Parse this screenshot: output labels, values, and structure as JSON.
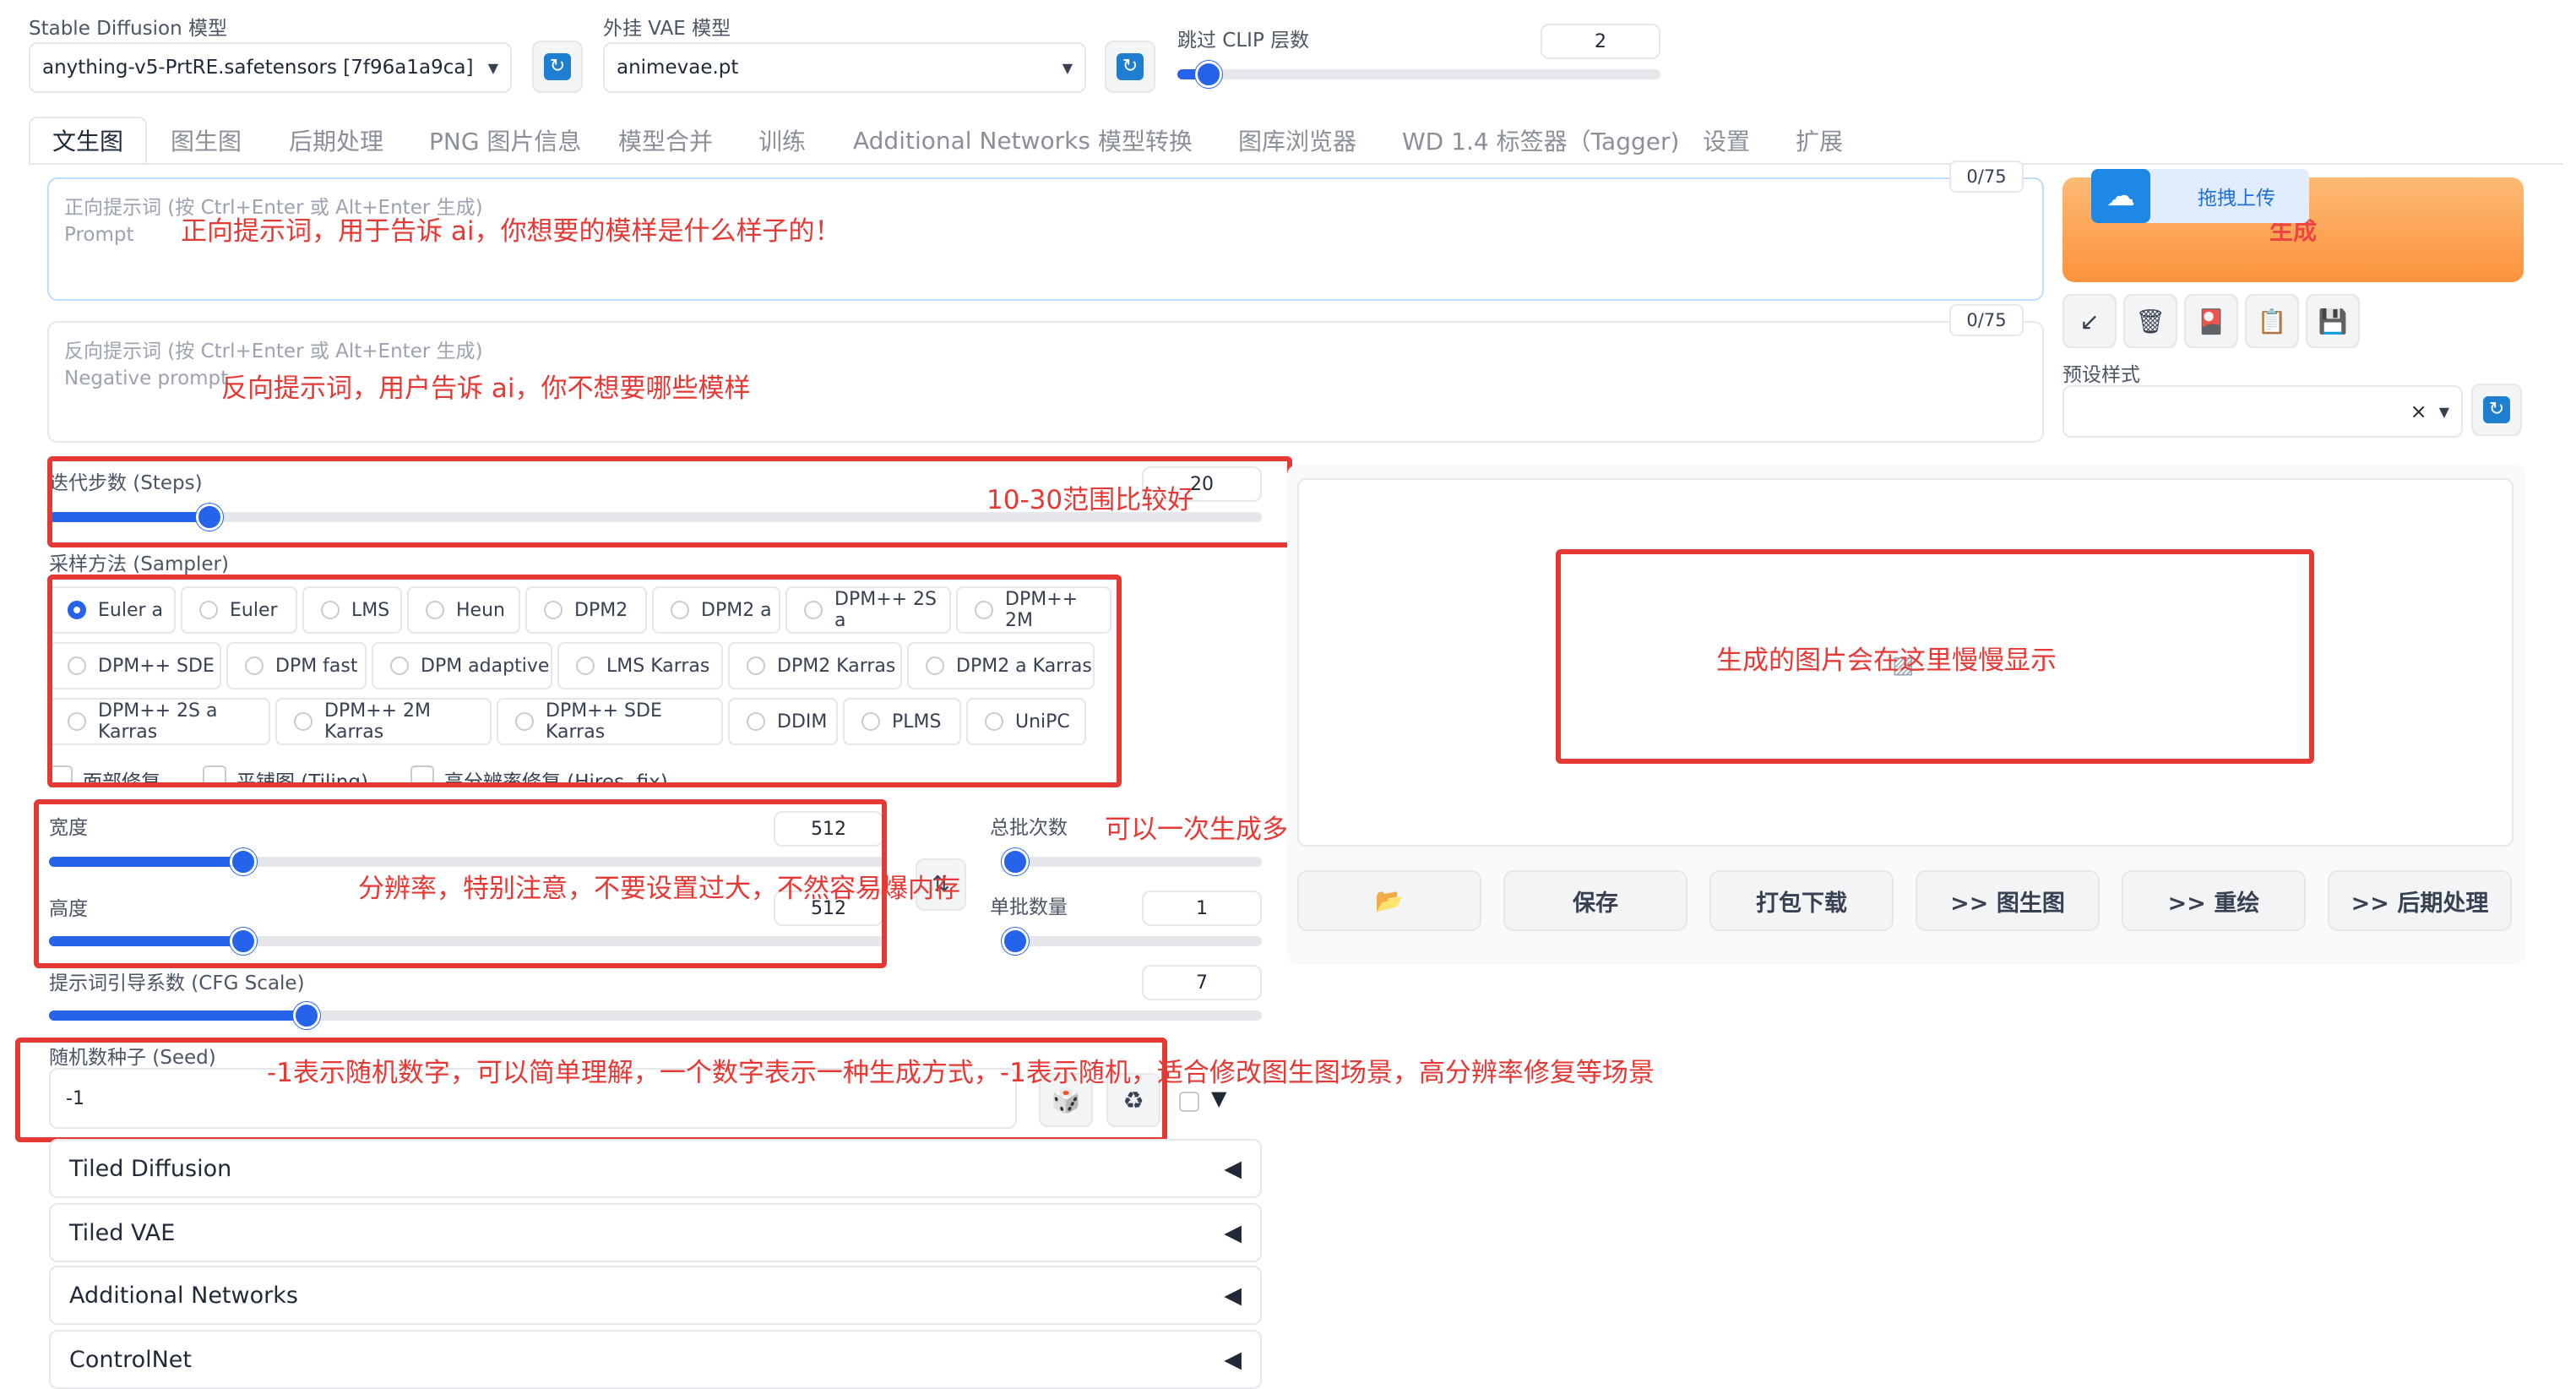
{
  "model_bar": {
    "sd_model_label": "Stable Diffusion 模型",
    "sd_model_value": "anything-v5-PrtRE.safetensors [7f96a1a9ca]",
    "vae_label": "外挂 VAE 模型",
    "vae_value": "animevae.pt",
    "clip_skip_label": "跳过 CLIP 层数",
    "clip_skip_value": "2",
    "clip_skip_fraction": 0.06
  },
  "tabs": [
    "文生图",
    "图生图",
    "后期处理",
    "PNG 图片信息",
    "模型合并",
    "训练",
    "Additional Networks",
    "模型转换",
    "图库浏览器",
    "WD 1.4 标签器（Tagger)",
    "设置",
    "扩展"
  ],
  "prompt": {
    "placeholder_line1": "正向提示词 (按 Ctrl+Enter 或 Alt+Enter 生成)",
    "placeholder_line2": "Prompt",
    "counter": "0/75"
  },
  "negative_prompt": {
    "placeholder_line1": "反向提示词 (按 Ctrl+Enter 或 Alt+Enter 生成)",
    "placeholder_line2": "Negative prompt",
    "counter": "0/75"
  },
  "generate": {
    "label": "生成",
    "upload_badge": "拖拽上传"
  },
  "toolbar_icons": [
    "arrow-icon",
    "trash-icon",
    "style-icon",
    "clipboard-icon",
    "save-icon"
  ],
  "styles": {
    "label": "预设样式",
    "clear": "×"
  },
  "steps": {
    "label": "迭代步数 (Steps)",
    "value": "20",
    "fraction": 0.13
  },
  "sampler": {
    "label": "采样方法 (Sampler)",
    "selected": "Euler a",
    "rows": [
      [
        "Euler a",
        "Euler",
        "LMS",
        "Heun",
        "DPM2",
        "DPM2 a",
        "DPM++ 2S a",
        "DPM++ 2M"
      ],
      [
        "DPM++ SDE",
        "DPM fast",
        "DPM adaptive",
        "LMS Karras",
        "DPM2 Karras",
        "DPM2 a Karras"
      ],
      [
        "DPM++ 2S a Karras",
        "DPM++ 2M Karras",
        "DPM++ SDE Karras",
        "DDIM",
        "PLMS",
        "UniPC"
      ]
    ]
  },
  "options": {
    "face_restore": "面部修复",
    "tiling": "平铺图 (Tiling)",
    "hires_fix": "高分辨率修复 (Hires. fix)"
  },
  "width": {
    "label": "宽度",
    "value": "512",
    "fraction": 0.23
  },
  "height": {
    "label": "高度",
    "value": "512",
    "fraction": 0.23
  },
  "batch_count": {
    "label": "总批次数",
    "value": "1",
    "fraction": 0.0
  },
  "batch_size": {
    "label": "单批数量",
    "value": "1",
    "fraction": 0.0
  },
  "cfg": {
    "label": "提示词引导系数 (CFG Scale)",
    "value": "7",
    "fraction": 0.21
  },
  "seed": {
    "label": "随机数种子 (Seed)",
    "value": "-1",
    "extra_toggle": "▼"
  },
  "accordions": [
    {
      "label": "Tiled Diffusion",
      "icon": "◀"
    },
    {
      "label": "Tiled VAE",
      "icon": "◀"
    },
    {
      "label": "Additional Networks",
      "icon": "◀"
    },
    {
      "label": "ControlNet",
      "icon": "◀"
    }
  ],
  "output_actions": [
    "📂",
    "保存",
    "打包下载",
    ">> 图生图",
    ">> 重绘",
    ">> 后期处理"
  ],
  "annotations": {
    "prompt": "正向提示词，用于告诉 ai，你想要的模样是什么样子的！",
    "negative": "反向提示词，用户告诉 ai，你不想要哪些模样",
    "steps": "10-30范围比较好",
    "output": "生成的图片会在这里慢慢显示",
    "batch": "可以一次生成多批图片，供你选择，推荐修改批次，不推荐修改数量",
    "resolution": "分辨率，特别注意，不要设置过大，不然容易爆内存",
    "seed": "-1表示随机数字，可以简单理解，一个数字表示一种生成方式，-1表示随机，适合修改图生图场景，高分辨率修复等场景"
  },
  "colors": {
    "accent": "#2563eb",
    "annotation": "#e53935",
    "generate_gradient_start": "#fdba74",
    "generate_gradient_end": "#fb923c"
  }
}
